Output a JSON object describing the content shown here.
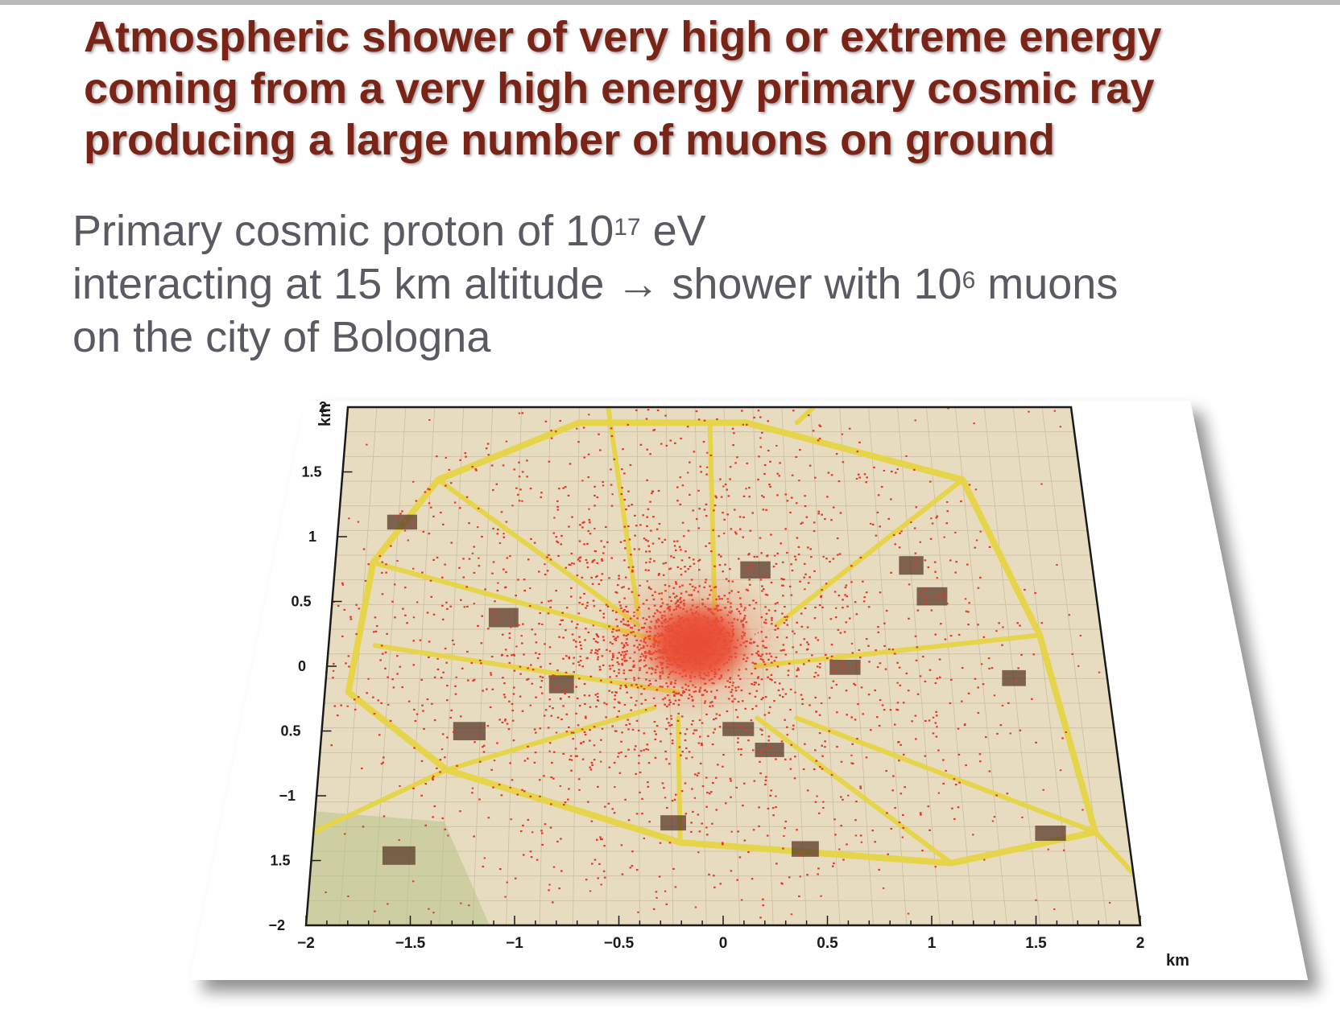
{
  "title": {
    "line1": "Atmospheric shower of very high or extreme energy",
    "line2": "coming from a very high energy primary cosmic ray",
    "line3": "producing a large number of muons on ground"
  },
  "subtitle": {
    "line1_before": "Primary cosmic proton of 10",
    "line1_sup": "17",
    "line1_after": " eV",
    "line2_before": "interacting at 15 km altitude → shower with 10",
    "line2_sup": "6",
    "line2_after": " muons",
    "line3": "on the city of Bologna"
  },
  "figure": {
    "x_ticks": [
      "−2",
      "−1.5",
      "−1",
      "−0.5",
      "0",
      "0.5",
      "1",
      "1.5",
      "2"
    ],
    "y_ticks": [
      "2",
      "1.5",
      "1",
      "0.5",
      "0",
      "0.5",
      "−1",
      "1.5",
      "−2"
    ],
    "x_unit": "km",
    "y_unit": "km",
    "colors": {
      "map_background": "#e8dcc0",
      "roads": "#e6d44a",
      "muon_hits": "#e23a2a",
      "buildings": "#5a3a2a"
    }
  }
}
